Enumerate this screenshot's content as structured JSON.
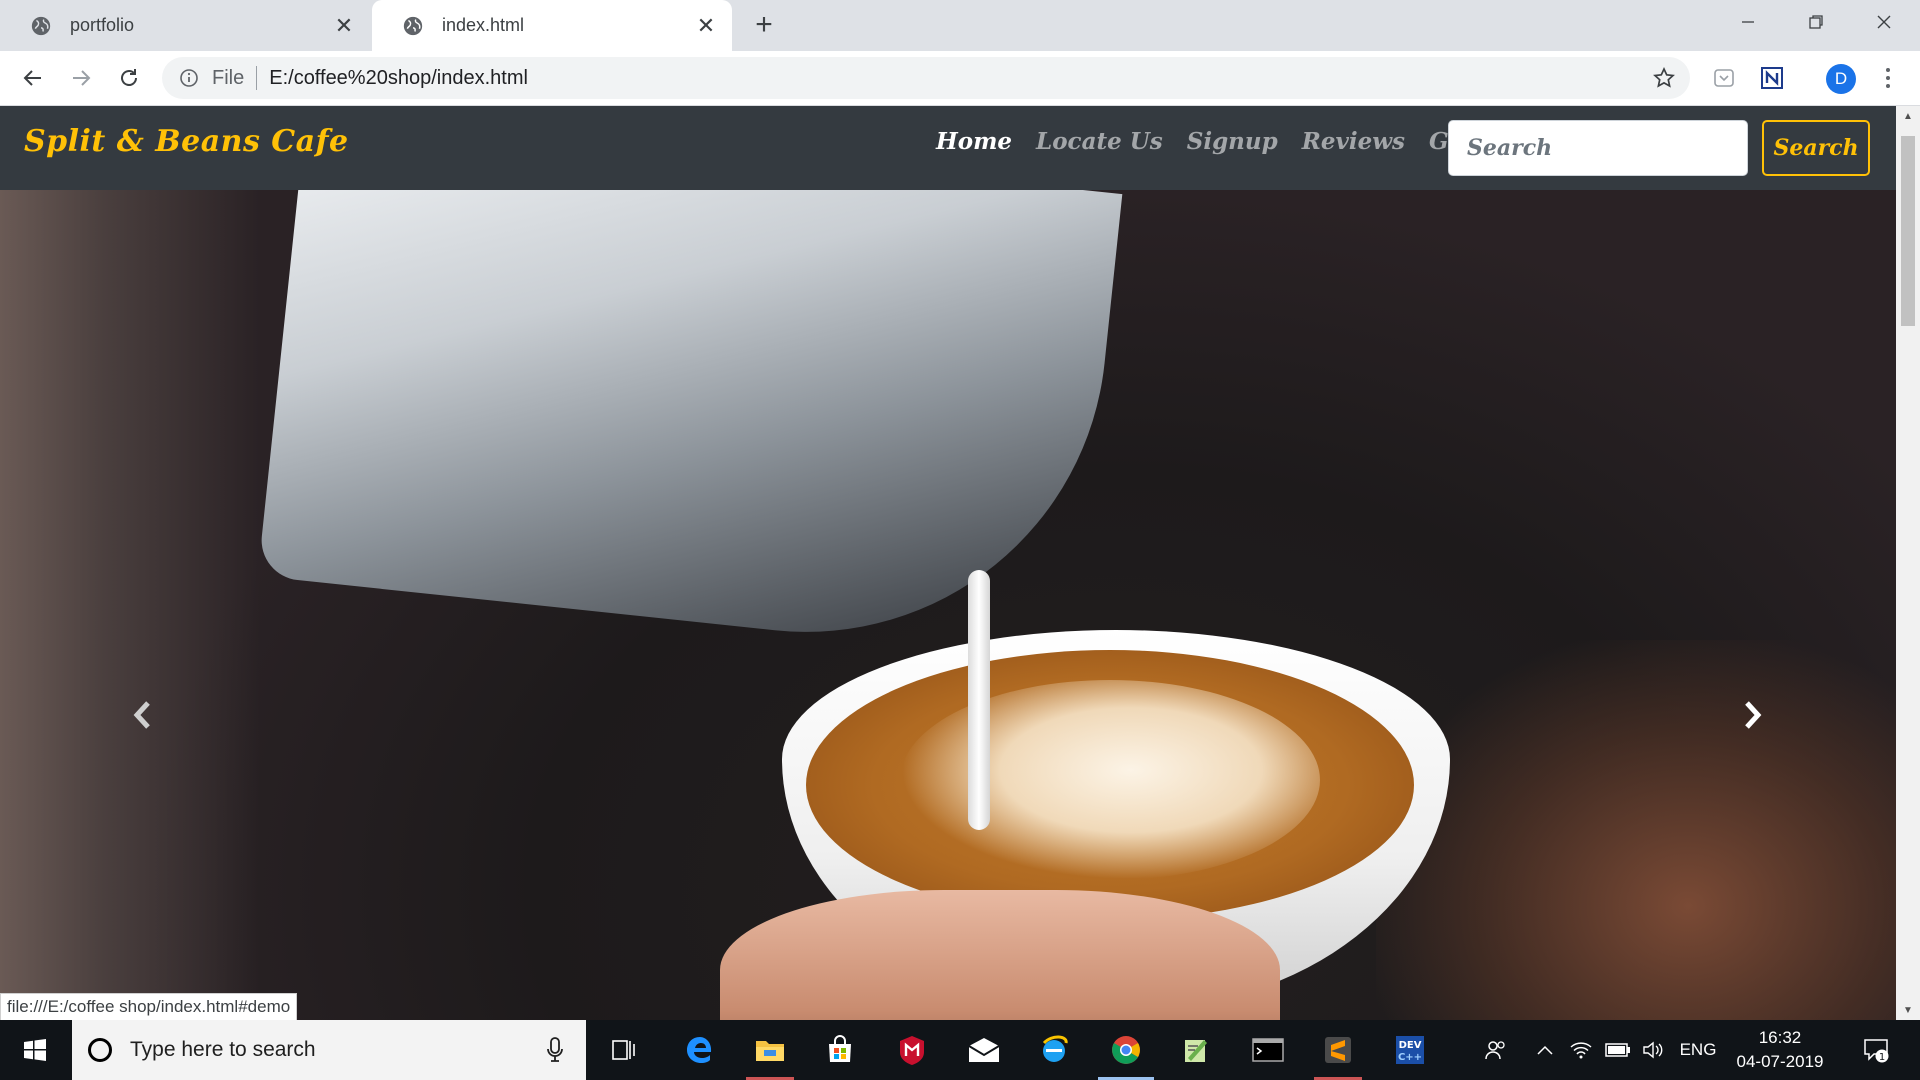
{
  "browser": {
    "tabs": [
      {
        "title": "portfolio",
        "active": false
      },
      {
        "title": "index.html",
        "active": true
      }
    ],
    "address": {
      "scheme": "File",
      "url": "E:/coffee%20shop/index.html"
    },
    "profile_initial": "D",
    "status_url": "file:///E:/coffee shop/index.html#demo",
    "icons": [
      "back-icon",
      "forward-icon",
      "reload-icon",
      "info-icon",
      "star-icon",
      "pocket-icon",
      "notion-icon",
      "menu-icon",
      "new-tab-icon",
      "minimize-icon",
      "restore-icon",
      "close-icon"
    ]
  },
  "site": {
    "brand": "Split & Beans Cafe",
    "nav": [
      {
        "label": "Home",
        "active": true
      },
      {
        "label": "Locate Us",
        "active": false
      },
      {
        "label": "Signup",
        "active": false
      },
      {
        "label": "Reviews",
        "active": false
      },
      {
        "label": "Gallery",
        "active": false
      }
    ],
    "search_placeholder": "Search",
    "search_button": "Search",
    "hero_image": "latte-art-pour-photo",
    "colors": {
      "navbar": "#343a40",
      "accent": "#ffc107",
      "nav_inactive": "rgba(255,255,255,0.55)"
    }
  },
  "taskbar": {
    "search_placeholder": "Type here to search",
    "apps": [
      "task-view",
      "edge",
      "file-explorer",
      "store",
      "mcafee",
      "mail",
      "internet-explorer",
      "chrome",
      "notepad-plus-plus",
      "terminal",
      "sublime-text",
      "dev-cpp"
    ],
    "language": "ENG",
    "time": "16:32",
    "date": "04-07-2019",
    "notification_count": "1"
  }
}
